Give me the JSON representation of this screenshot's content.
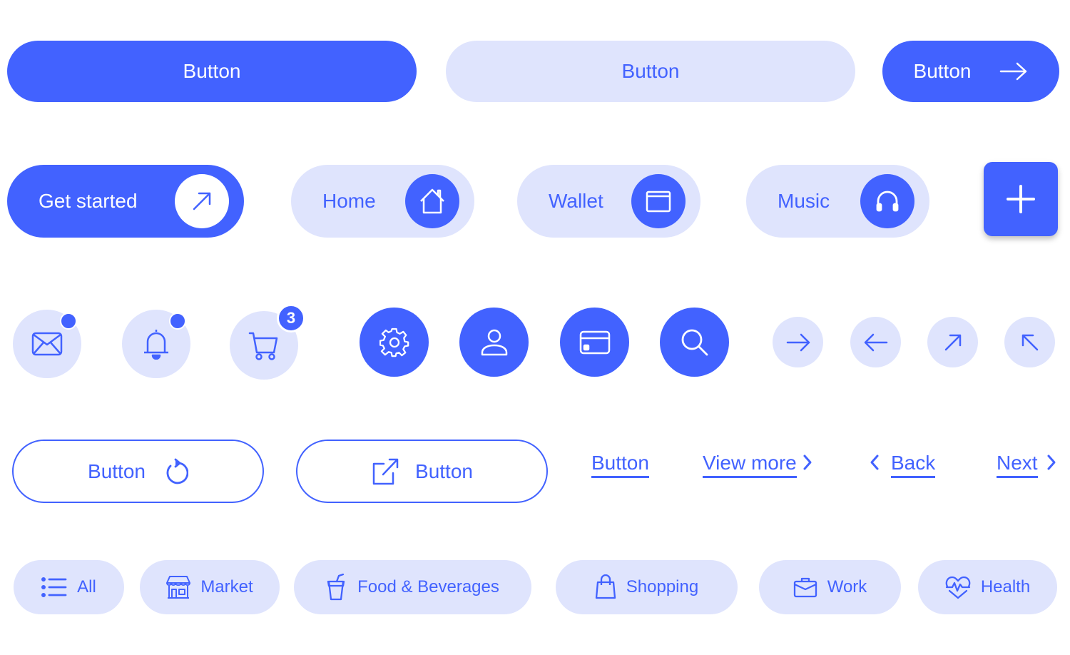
{
  "colors": {
    "primary": "#4262ff",
    "soft": "#dfe4fd",
    "white": "#ffffff"
  },
  "row1": {
    "primary_button": "Button",
    "soft_button": "Button",
    "arrow_button": {
      "label": "Button",
      "icon": "arrow-right-icon"
    }
  },
  "row2": {
    "get_started": {
      "label": "Get started",
      "icon": "arrow-up-right-icon"
    },
    "home": {
      "label": "Home",
      "icon": "home-icon"
    },
    "wallet": {
      "label": "Wallet",
      "icon": "wallet-icon"
    },
    "music": {
      "label": "Music",
      "icon": "headphones-icon"
    },
    "fab": {
      "icon": "plus-icon"
    }
  },
  "row3": {
    "notifications": [
      {
        "icon": "mail-icon",
        "indicator": "dot"
      },
      {
        "icon": "bell-icon",
        "indicator": "dot"
      },
      {
        "icon": "cart-icon",
        "indicator": "badge",
        "count": "3"
      }
    ],
    "solid_icons": [
      "settings-icon",
      "user-icon",
      "credit-card-icon",
      "search-icon"
    ],
    "arrow_icons": [
      "arrow-right-icon",
      "arrow-left-icon",
      "arrow-up-right-icon",
      "arrow-up-left-icon"
    ]
  },
  "row4": {
    "outline_refresh": {
      "label": "Button",
      "icon": "refresh-icon"
    },
    "outline_external": {
      "label": "Button",
      "icon": "external-link-icon"
    },
    "links": {
      "plain": "Button",
      "view_more": "View more",
      "back": "Back",
      "next": "Next"
    }
  },
  "chips": [
    {
      "label": "All",
      "icon": "list-icon"
    },
    {
      "label": "Market",
      "icon": "store-icon"
    },
    {
      "label": "Food & Beverages",
      "icon": "drink-cup-icon"
    },
    {
      "label": "Shopping",
      "icon": "shopping-bag-icon"
    },
    {
      "label": "Work",
      "icon": "briefcase-icon"
    },
    {
      "label": "Health",
      "icon": "heart-pulse-icon"
    }
  ]
}
